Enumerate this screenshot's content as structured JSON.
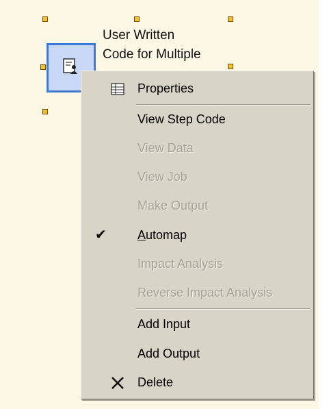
{
  "node": {
    "label_line1": "User Written",
    "label_line2": "Code for Multiple",
    "icon": "user-code-icon"
  },
  "context_menu": {
    "items": [
      {
        "label": "Properties",
        "icon": "properties-grid-icon",
        "enabled": true
      },
      {
        "label": "View Step Code",
        "enabled": true
      },
      {
        "label": "View Data",
        "enabled": false
      },
      {
        "label": "View Job",
        "enabled": false
      },
      {
        "label": "Make Output",
        "enabled": false
      },
      {
        "label": "Automap",
        "enabled": true,
        "checked": true,
        "mnemonic": "A"
      },
      {
        "label": "Impact Analysis",
        "enabled": false
      },
      {
        "label": "Reverse Impact Analysis",
        "enabled": false
      },
      {
        "label": "Add Input",
        "enabled": true
      },
      {
        "label": "Add Output",
        "enabled": true
      },
      {
        "label": "Delete",
        "icon": "delete-x-icon",
        "enabled": true
      }
    ]
  },
  "colors": {
    "canvas": "#fdf8e6",
    "menu_bg": "#d8d4c8",
    "selection_border": "#3f7ad8",
    "handle": "#f4be2c"
  }
}
